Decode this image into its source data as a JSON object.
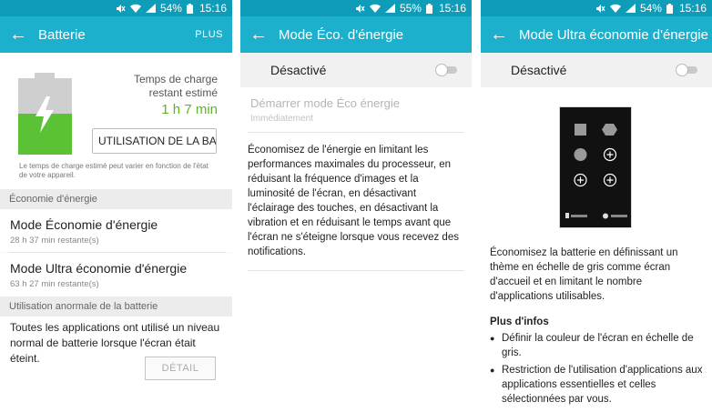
{
  "status": {
    "battery": "54%",
    "battery2": "55%",
    "time": "15:16"
  },
  "screen1": {
    "title": "Batterie",
    "action": "PLUS",
    "battery_level": 0.54,
    "charge_label": "Temps de charge restant estimé",
    "charge_time": "1 h 7 min",
    "usage_button": "UTILISATION DE LA BAT…",
    "note": "Le temps de charge estimé peut varier en fonction de l'état de votre appareil.",
    "section_eco": "Économie d'énergie",
    "items": [
      {
        "title": "Mode Économie d'énergie",
        "sub": "28 h 37 min restante(s)"
      },
      {
        "title": "Mode Ultra économie d'énergie",
        "sub": "63 h 27 min restante(s)"
      }
    ],
    "section_abnormal": "Utilisation anormale de la batterie",
    "abnormal_text": "Toutes les applications ont utilisé un niveau normal de batterie lorsque l'écran était éteint.",
    "detail_button": "DÉTAIL"
  },
  "screen2": {
    "title": "Mode Éco. d'énergie",
    "toggle_label": "Désactivé",
    "start_title": "Démarrer mode Éco énergie",
    "start_sub": "Immédiatement",
    "description": "Économisez de l'énergie en limitant les performances maximales du processeur, en réduisant la fréquence d'images et la luminosité de l'écran, en désactivant l'éclairage des touches, en désactivant la vibration et en réduisant le temps avant que l'écran ne s'éteigne lorsque vous recevez des notifications."
  },
  "screen3": {
    "title": "Mode Ultra économie d'énergie",
    "toggle_label": "Désactivé",
    "description": "Économisez la batterie en définissant un thème en échelle de gris comme écran d'accueil et en limitant le nombre d'applications utilisables.",
    "info_header": "Plus d'infos",
    "bullets": [
      "Définir la couleur de l'écran en échelle de gris.",
      "Restriction de l'utilisation d'applications aux applications essentielles et celles sélectionnées par vous."
    ]
  },
  "icons": [
    "back-arrow-icon",
    "wifi-icon",
    "signal-icon",
    "mute-icon",
    "battery-icon",
    "lightning-bolt-icon"
  ]
}
